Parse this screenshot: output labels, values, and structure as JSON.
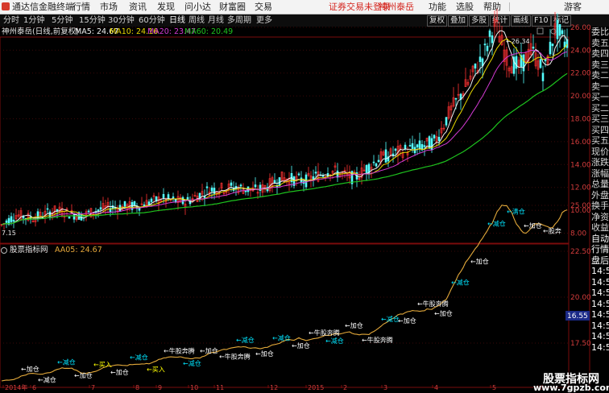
{
  "menubar": {
    "app_title": "通达信金融终端",
    "menus": [
      "行情",
      "市场",
      "资讯",
      "发现",
      "问小达",
      "财富圈",
      "交易"
    ],
    "alert": "证券交易未登录",
    "stock_name": "神州泰岳",
    "right_items": [
      "功能",
      "选股",
      "帮助",
      "游客"
    ]
  },
  "periods": [
    "分时",
    "1分钟",
    "5分钟",
    "15分钟",
    "30分钟",
    "60分钟",
    "日线",
    "周线",
    "月线",
    "多周期",
    "更多"
  ],
  "toolbar": [
    "复权",
    "叠加",
    "多股",
    "统计",
    "画线",
    "F10",
    "标记"
  ],
  "stock_info": {
    "title": "神州泰岳(日线,前复权)",
    "ma5": "MA5: 24.67",
    "ma10": "MA10: 24.16",
    "ma20": "MA20: 23.47",
    "ma60": "MA60: 20.49"
  },
  "chart_data": {
    "type": "candlestick",
    "price_axis_ticks": [
      "26.00",
      "24.00",
      "22.00",
      "20.00",
      "18.00",
      "16.00",
      "14.00",
      "12.00",
      "10.00",
      "8.00"
    ],
    "high_label": "26.34",
    "low_label": "7.15",
    "indicator_ticks": [
      "25.00",
      "22.50",
      "20.00",
      "17.50"
    ],
    "indicator_highlight": "16.55",
    "indicator_line_name": "AA05: 24.67",
    "indicator_title": "股票指标网",
    "x_labels": [
      "2014年",
      "6",
      "7",
      "8",
      "9",
      "10",
      "11",
      "12",
      "2015",
      "2",
      "3",
      "4",
      "5",
      "6"
    ],
    "series_colors": {
      "ma5": "#f0f0f0",
      "ma10": "#e8d800",
      "ma20": "#d33ad3",
      "ma60": "#1ec31e",
      "aa05": "#e2a83a"
    },
    "signals": [
      {
        "text": "加仓",
        "color": "#ffffff"
      },
      {
        "text": "减仓",
        "color": "#ffffff"
      },
      {
        "text": "减仓",
        "color": "#00e5ff"
      },
      {
        "text": "加仓",
        "color": "#ffffff"
      },
      {
        "text": "买入",
        "color": "#ffff00"
      },
      {
        "text": "加仓",
        "color": "#ffffff"
      },
      {
        "text": "减仓",
        "color": "#00e5ff"
      },
      {
        "text": "买入",
        "color": "#ffff00"
      },
      {
        "text": "牛股奔腾",
        "color": "#ffffff"
      },
      {
        "text": "减仓",
        "color": "#00e5ff"
      },
      {
        "text": "加仓",
        "color": "#ffffff"
      },
      {
        "text": "牛股奔腾",
        "color": "#ffffff"
      },
      {
        "text": "减仓",
        "color": "#00e5ff"
      },
      {
        "text": "加仓",
        "color": "#ffffff"
      },
      {
        "text": "减仓",
        "color": "#00e5ff"
      },
      {
        "text": "加仓",
        "color": "#ffffff"
      },
      {
        "text": "牛股奔腾",
        "color": "#ffffff"
      },
      {
        "text": "减仓",
        "color": "#00e5ff"
      },
      {
        "text": "加仓",
        "color": "#ffffff"
      },
      {
        "text": "牛股奔腾",
        "color": "#ffffff"
      },
      {
        "text": "减仓",
        "color": "#00e5ff"
      },
      {
        "text": "加仓",
        "color": "#ffffff"
      },
      {
        "text": "牛股奔腾",
        "color": "#ffffff"
      },
      {
        "text": "加仓",
        "color": "#ffffff"
      },
      {
        "text": "减仓",
        "color": "#00e5ff"
      },
      {
        "text": "加仓",
        "color": "#ffffff"
      },
      {
        "text": "减仓",
        "color": "#00e5ff"
      },
      {
        "text": "清仓",
        "color": "#00e5ff"
      },
      {
        "text": "加仓",
        "color": "#ffffff"
      },
      {
        "text": "股奔",
        "color": "#ffffff"
      }
    ]
  },
  "right_panel": [
    "委比",
    "卖五",
    "卖四",
    "卖三",
    "卖二",
    "卖一",
    "买一",
    "买二",
    "买三",
    "买四",
    "买五",
    "现价",
    "涨跌",
    "涨幅",
    "总量",
    "外盘",
    "换手",
    "净资",
    "收益",
    "自动",
    "行情",
    "盘后",
    "14:5",
    "14:5",
    "14:5",
    "14:5",
    "14:5",
    "14:5",
    "14:5",
    "14:5"
  ],
  "watermark": {
    "line1": "股票指标网",
    "line2": "www.7gpzb.com"
  }
}
